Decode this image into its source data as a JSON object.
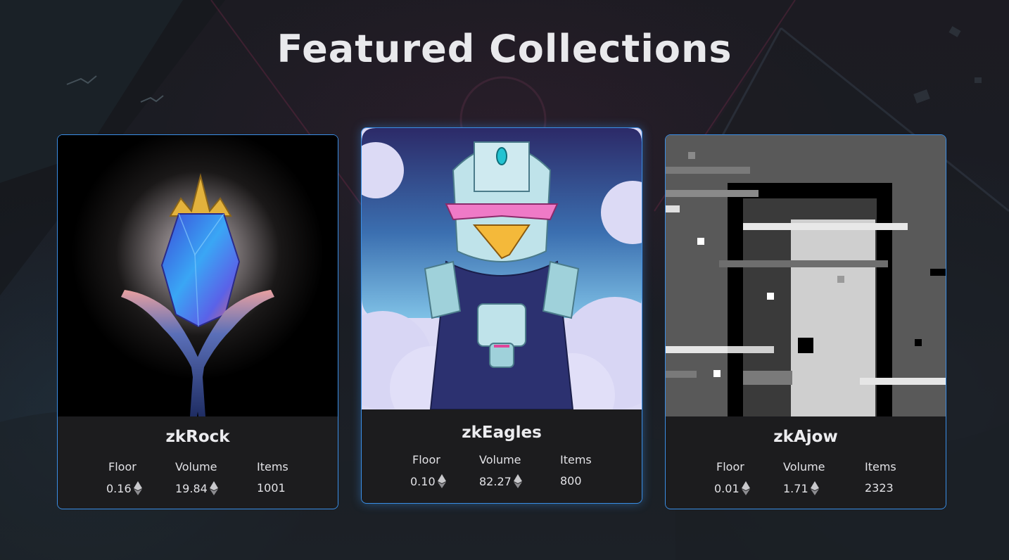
{
  "section": {
    "title": "Featured Collections"
  },
  "currency_icon": "ethereum-icon",
  "colors": {
    "card_border": "#3a8ee6",
    "card_background": "#1c1c1e",
    "page_background": "#1b1a21"
  },
  "collections": [
    {
      "name": "zkRock",
      "floor_label": "Floor",
      "volume_label": "Volume",
      "items_label": "Items",
      "floor": "0.16",
      "volume": "19.84",
      "items": "1001",
      "image": "glowing-blue-crystal-held-in-hands"
    },
    {
      "name": "zkEagles",
      "floor_label": "Floor",
      "volume_label": "Volume",
      "items_label": "Items",
      "floor": "0.10",
      "volume": "82.27",
      "items": "800",
      "image": "armored-eagle-character"
    },
    {
      "name": "zkAjow",
      "floor_label": "Floor",
      "volume_label": "Volume",
      "items_label": "Items",
      "floor": "0.01",
      "volume": "1.71",
      "items": "2323",
      "image": "grayscale-pixel-glitch-art"
    }
  ]
}
